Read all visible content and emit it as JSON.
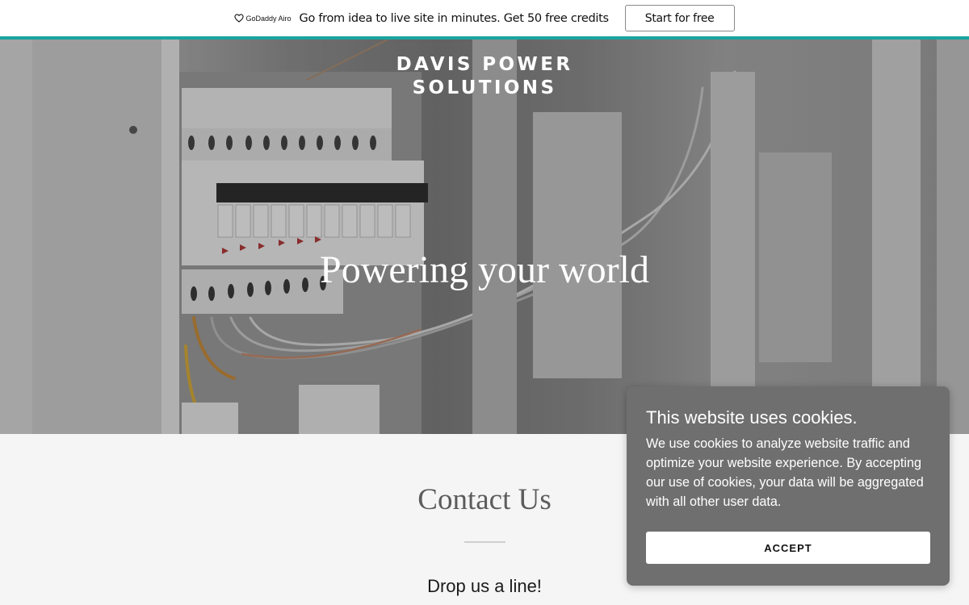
{
  "promo": {
    "logo_text": "GoDaddy Airo",
    "message": "Go from idea to live site in minutes. Get 50 free credits",
    "cta_label": "Start for free",
    "accent_color": "#1ba4a0"
  },
  "hero": {
    "brand_line1": "DAVIS POWER",
    "brand_line2": "SOLUTIONS",
    "headline": "Powering your world",
    "image": "electrical-panel-photo"
  },
  "contact": {
    "title": "Contact Us",
    "subtitle": "Drop us a line!"
  },
  "cookie_banner": {
    "title": "This website uses cookies.",
    "body": "We use cookies to analyze website traffic and optimize your website experience. By accepting our use of cookies, your data will be aggregated with all other user data.",
    "accept_label": "ACCEPT"
  }
}
